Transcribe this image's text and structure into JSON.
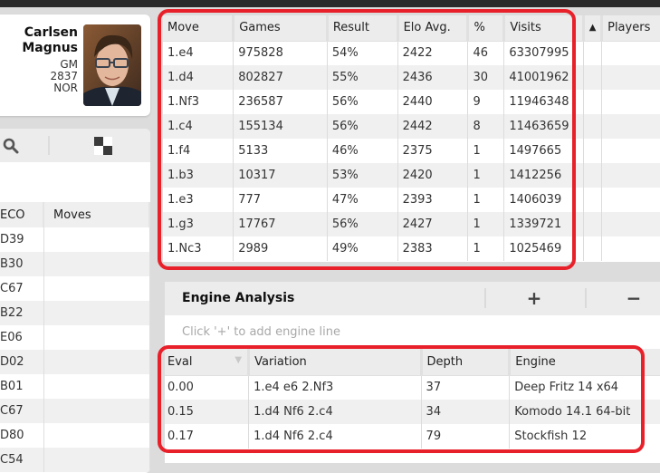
{
  "player": {
    "first_line": "Carlsen",
    "second_line": "Magnus",
    "title": "GM",
    "rating": "2837",
    "federation": "NOR"
  },
  "left_panel": {
    "toolbar": {
      "search_icon": "magnifier",
      "board_icon": "checkerboard"
    },
    "columns": [
      "ECO",
      "Moves"
    ],
    "rows": [
      {
        "eco": "D39",
        "moves": ""
      },
      {
        "eco": "B30",
        "moves": ""
      },
      {
        "eco": "C67",
        "moves": ""
      },
      {
        "eco": "B22",
        "moves": ""
      },
      {
        "eco": "E06",
        "moves": ""
      },
      {
        "eco": "D02",
        "moves": ""
      },
      {
        "eco": "B01",
        "moves": ""
      },
      {
        "eco": "C67",
        "moves": ""
      },
      {
        "eco": "D80",
        "moves": ""
      },
      {
        "eco": "C54",
        "moves": ""
      }
    ]
  },
  "opening_tree": {
    "columns": [
      "Move",
      "Games",
      "Result",
      "Elo Avg.",
      "%",
      "Visits",
      "",
      "Players"
    ],
    "sort_indicator": "▲",
    "rows": [
      {
        "move": "1.e4",
        "games": "975828",
        "result": "54%",
        "elo": "2422",
        "pct": "46",
        "visits": "63307995"
      },
      {
        "move": "1.d4",
        "games": "802827",
        "result": "55%",
        "elo": "2436",
        "pct": "30",
        "visits": "41001962"
      },
      {
        "move": "1.Nf3",
        "games": "236587",
        "result": "56%",
        "elo": "2440",
        "pct": "9",
        "visits": "11946348"
      },
      {
        "move": "1.c4",
        "games": "155134",
        "result": "56%",
        "elo": "2442",
        "pct": "8",
        "visits": "11463659"
      },
      {
        "move": "1.f4",
        "games": "5133",
        "result": "46%",
        "elo": "2375",
        "pct": "1",
        "visits": "1497665"
      },
      {
        "move": "1.b3",
        "games": "10317",
        "result": "53%",
        "elo": "2420",
        "pct": "1",
        "visits": "1412256"
      },
      {
        "move": "1.e3",
        "games": "777",
        "result": "47%",
        "elo": "2393",
        "pct": "1",
        "visits": "1406039"
      },
      {
        "move": "1.g3",
        "games": "17767",
        "result": "56%",
        "elo": "2427",
        "pct": "1",
        "visits": "1339721"
      },
      {
        "move": "1.Nc3",
        "games": "2989",
        "result": "49%",
        "elo": "2383",
        "pct": "1",
        "visits": "1025469"
      }
    ]
  },
  "engine_analysis": {
    "title": "Engine Analysis",
    "add_label": "+",
    "remove_label": "−",
    "hint": "Click '+' to add engine line",
    "sort_indicator": "▼",
    "columns": [
      "Eval",
      "Variation",
      "Depth",
      "Engine"
    ],
    "rows": [
      {
        "eval": "0.00",
        "variation": "1.e4 e6 2.Nf3",
        "depth": "37",
        "engine": "Deep Fritz 14 x64"
      },
      {
        "eval": "0.15",
        "variation": "1.d4 Nf6 2.c4",
        "depth": "34",
        "engine": "Komodo 14.1 64-bit"
      },
      {
        "eval": "0.17",
        "variation": "1.d4 Nf6 2.c4",
        "depth": "79",
        "engine": "Stockfish 12"
      }
    ]
  },
  "colors": {
    "highlight": "#e8202a",
    "header_bg": "#ececec",
    "stripe": "#f0f0f0"
  }
}
